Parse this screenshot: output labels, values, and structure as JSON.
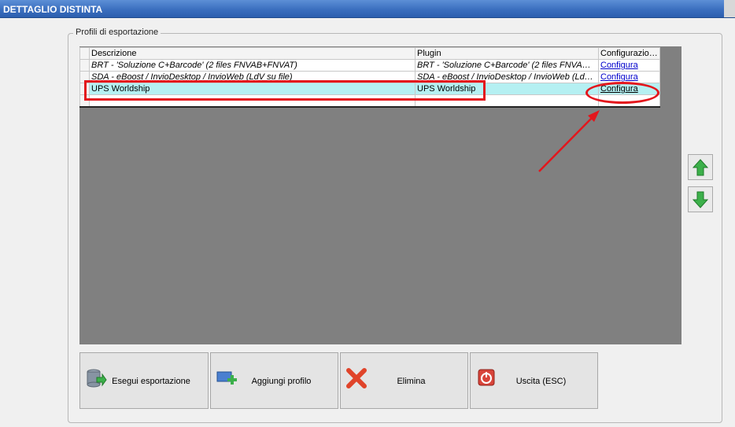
{
  "window": {
    "title": "DETTAGLIO DISTINTA"
  },
  "group": {
    "legend": "Profili di esportazione"
  },
  "grid": {
    "columns": [
      "Descrizione",
      "Plugin",
      "Configurazione"
    ],
    "rows": [
      {
        "descrizione": "BRT - 'Soluzione C+Barcode' (2 files FNVAB+FNVAT)",
        "plugin": "BRT - 'Soluzione C+Barcode' (2 files FNVAB+FNVAT)",
        "configurazione": "Configura"
      },
      {
        "descrizione": "SDA - eBoost / InvioDesktop / InvioWeb (LdV su file)",
        "plugin": "SDA - eBoost / InvioDesktop / InvioWeb (LdV su file)",
        "configurazione": "Configura"
      },
      {
        "descrizione": "UPS Worldship",
        "plugin": "UPS Worldship",
        "configurazione": "Configura"
      }
    ]
  },
  "buttons": {
    "export": "Esegui esportazione",
    "add": "Aggiungi profilo",
    "delete": "Elimina",
    "exit": "Uscita (ESC)"
  },
  "colors": {
    "highlight": "#e3161c",
    "selected_row": "#b5f0f2",
    "grid_bg": "#808080",
    "titlebar": "#3b6fbf"
  }
}
